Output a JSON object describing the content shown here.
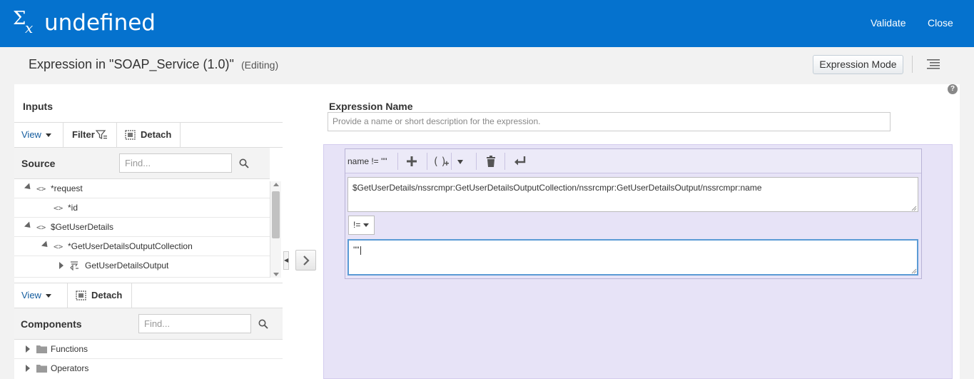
{
  "header": {
    "title": "undefined",
    "validate_label": "Validate",
    "close_label": "Close"
  },
  "subbar": {
    "title": "Expression in \"SOAP_Service (1.0)\"",
    "status": "(Editing)",
    "mode_button": "Expression Mode"
  },
  "help": "?",
  "inputs": {
    "title": "Inputs",
    "toolbar": {
      "view_label": "View",
      "filter_label": "Filter",
      "detach_label": "Detach"
    },
    "source": {
      "label": "Source",
      "find_placeholder": "Find...",
      "tree": [
        {
          "label": "*request"
        },
        {
          "label": "*id"
        },
        {
          "label": "$GetUserDetails"
        },
        {
          "label": "*GetUserDetailsOutputCollection"
        },
        {
          "label": "GetUserDetailsOutput"
        }
      ]
    },
    "components_toolbar": {
      "view_label": "View",
      "detach_label": "Detach"
    },
    "components": {
      "label": "Components",
      "find_placeholder": "Find...",
      "tree": [
        {
          "label": "Functions"
        },
        {
          "label": "Operators"
        }
      ]
    }
  },
  "expression": {
    "name_label": "Expression Name",
    "name_placeholder": "Provide a name or short description for the expression.",
    "builder": {
      "summary": "name != \"\"",
      "left_operand": "$GetUserDetails/nssrcmpr:GetUserDetailsOutputCollection/nssrcmpr:GetUserDetailsOutput/nssrcmpr:name",
      "operator": "!=",
      "right_operand": "\"\""
    }
  },
  "colors": {
    "header_bg": "#0572ce",
    "builder_bg": "#e7e3f7",
    "link": "#145c9e"
  }
}
